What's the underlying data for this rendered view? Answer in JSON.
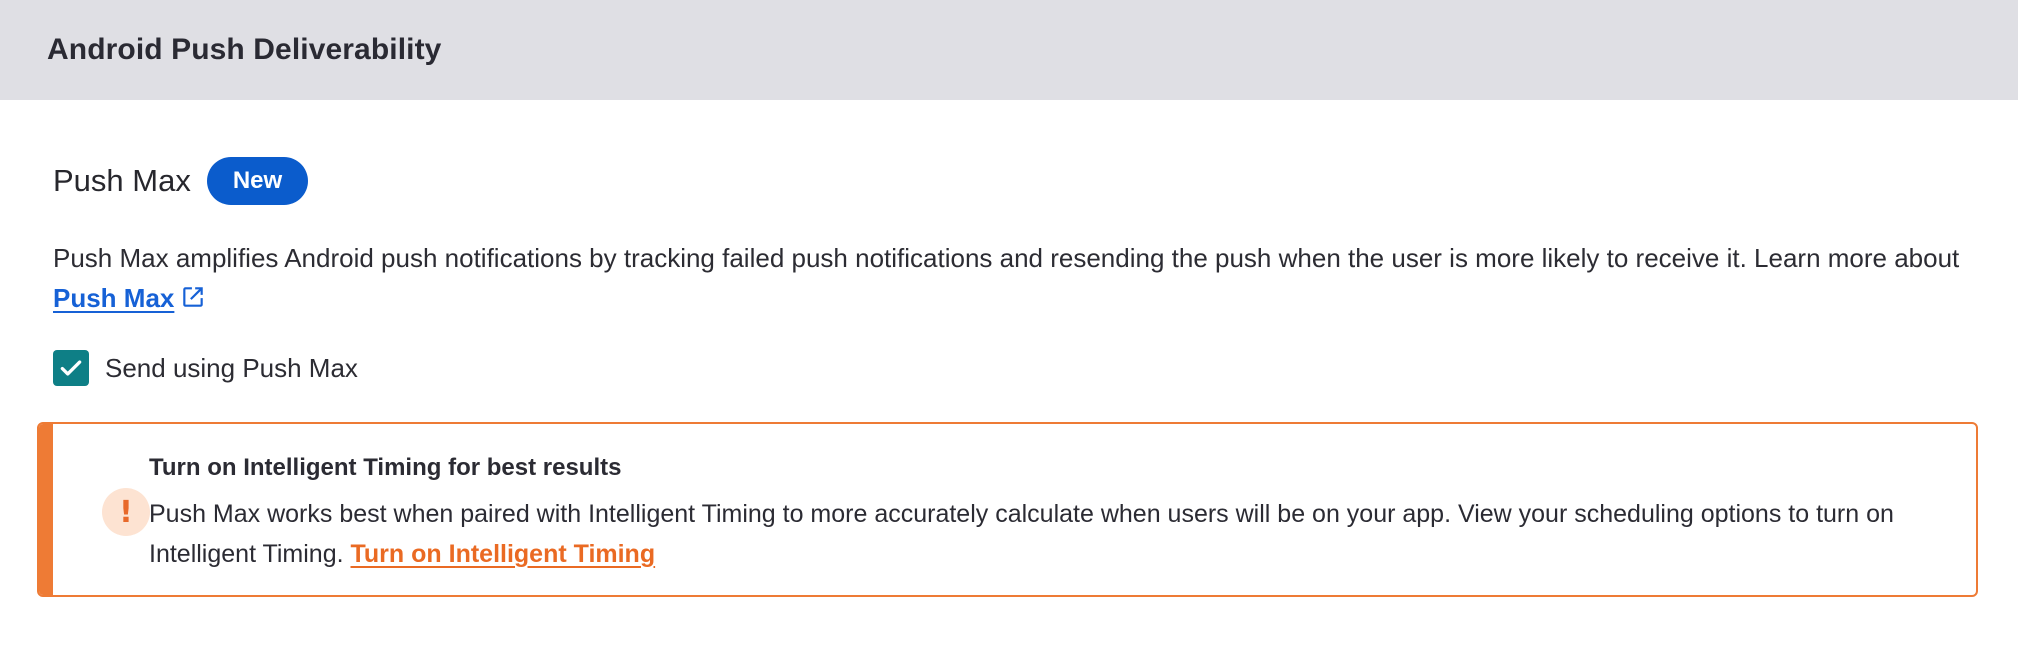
{
  "header": {
    "title": "Android Push Deliverability"
  },
  "section": {
    "title": "Push Max",
    "badge": "New",
    "description_prefix": "Push Max amplifies Android push notifications by tracking failed push notifications and resending the push when the user is more likely to receive it. Learn more about ",
    "learn_more_link": "Push Max",
    "external_link_icon": "external-link-icon"
  },
  "checkbox": {
    "label": "Send using Push Max",
    "checked": true
  },
  "alert": {
    "icon": "exclamation-icon",
    "title": "Turn on Intelligent Timing for best results",
    "text": "Push Max works best when paired with Intelligent Timing to more accurately calculate when users will be on your app. View your scheduling options to turn on Intelligent Timing. ",
    "link": "Turn on Intelligent Timing"
  },
  "colors": {
    "header_bg": "#dfdfe4",
    "badge_bg": "#0b5ccc",
    "link_blue": "#1661d6",
    "checkbox_teal": "#0e7f86",
    "alert_orange": "#ee7b35",
    "alert_icon_bg": "#fde3d2"
  }
}
